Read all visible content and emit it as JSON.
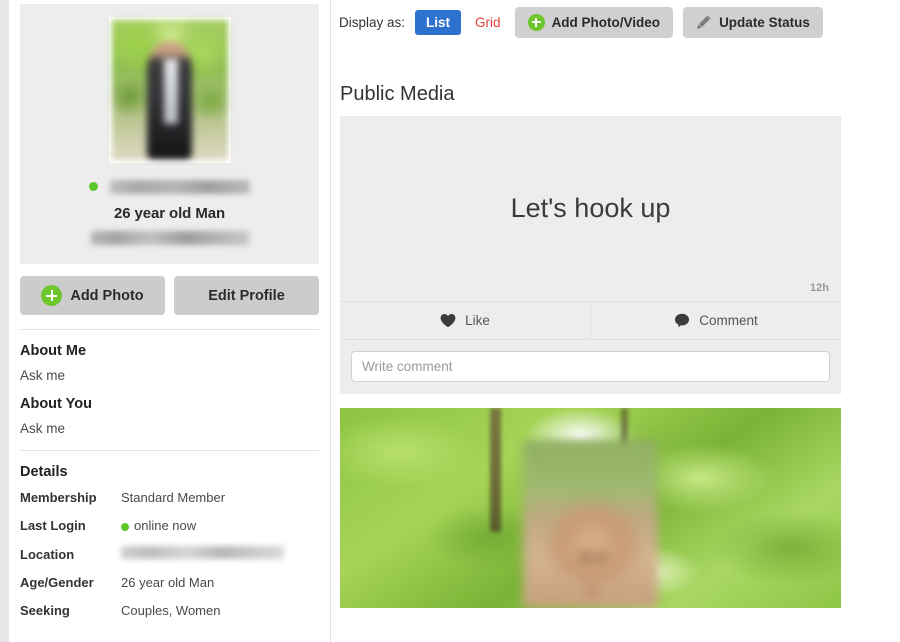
{
  "sidebar": {
    "profile": {
      "avatar_alt": "profile-photo-blurred",
      "username_redacted": true,
      "online_status": "online",
      "age_gender_line": "26 year old Man",
      "location_redacted": true
    },
    "buttons": {
      "add_photo": "Add Photo",
      "edit_profile": "Edit Profile"
    },
    "about_me": {
      "title": "About Me",
      "text": "Ask me"
    },
    "about_you": {
      "title": "About You",
      "text": "Ask me"
    },
    "details": {
      "title": "Details",
      "rows": [
        {
          "label": "Membership",
          "value": "Standard Member",
          "type": "text"
        },
        {
          "label": "Last Login",
          "value": "online now",
          "type": "status"
        },
        {
          "label": "Location",
          "value": "",
          "type": "redacted"
        },
        {
          "label": "Age/Gender",
          "value": "26 year old Man",
          "type": "text"
        },
        {
          "label": "Seeking",
          "value": "Couples, Women",
          "type": "text"
        }
      ]
    }
  },
  "main": {
    "toolbar": {
      "display_as_label": "Display as:",
      "list_label": "List",
      "grid_label": "Grid",
      "add_photo_video_label": "Add Photo/Video",
      "update_status_label": "Update Status"
    },
    "section_heading": "Public Media",
    "status_post": {
      "text": "Let's hook up",
      "time": "12h",
      "like_label": "Like",
      "comment_label": "Comment",
      "comment_placeholder": "Write comment"
    },
    "photo_post": {
      "alt": "outdoor-foliage-photo-blurred-face"
    }
  },
  "colors": {
    "accent_blue": "#2d72ce",
    "accent_red": "#e8413c",
    "accent_green": "#6dc62c",
    "status_green": "#5cc72b",
    "button_grey": "#d0d0d0",
    "card_grey": "#ededed"
  }
}
